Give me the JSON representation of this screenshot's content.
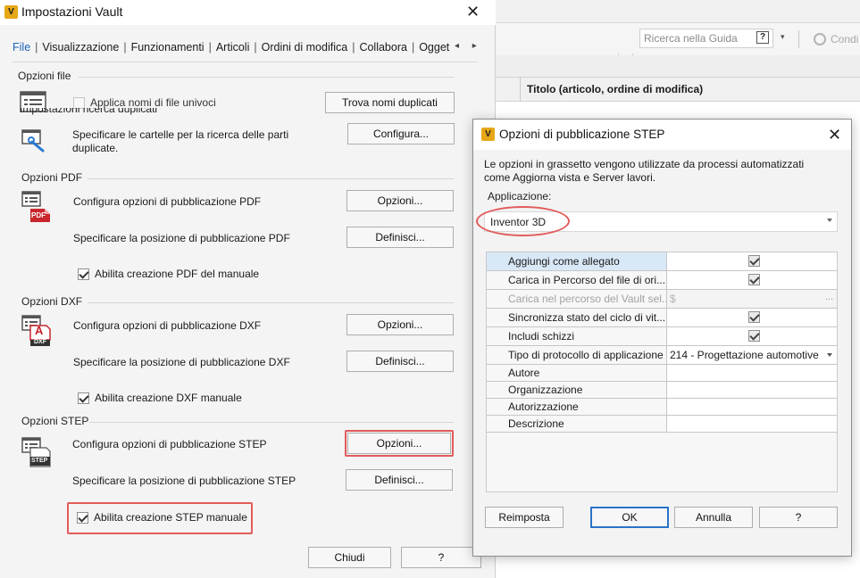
{
  "background_app": {
    "search_placeholder": "Ricerca nella Guida",
    "help_glyph": "?",
    "conditions_label": "Condi",
    "column_title": "Titolo (articolo, ordine di modifica)"
  },
  "settings_dialog": {
    "logo_letter": "V",
    "title": "Impostazioni Vault",
    "close_glyph": "✕",
    "tabs": [
      {
        "label": "File"
      },
      {
        "label": "Visualizzazione"
      },
      {
        "label": "Funzionamenti"
      },
      {
        "label": "Articoli"
      },
      {
        "label": "Ordini di modifica"
      },
      {
        "label": "Collabora"
      },
      {
        "label": "Ogget"
      }
    ],
    "tab_separator": "|",
    "tab_arrows": "◂ ▸",
    "file_options": {
      "heading": "Opzioni file",
      "unique_names_label": "Applica nomi di file univoci",
      "find_duplicates_button": "Trova nomi duplicati",
      "dup_search_heading": "Impostazioni ricerca duplicati",
      "dup_search_desc_1": "Specificare le cartelle per la ricerca delle parti",
      "dup_search_desc_2": "duplicate.",
      "configure_button": "Configura..."
    },
    "pdf": {
      "heading": "Opzioni PDF",
      "icon_label": "PDF",
      "configure_label": "Configura opzioni di pubblicazione PDF",
      "options_button": "Opzioni...",
      "location_label": "Specificare la posizione di pubblicazione PDF",
      "define_button": "Definisci...",
      "manual_label": "Abilita creazione PDF del manuale"
    },
    "dxf": {
      "heading": "Opzioni DXF",
      "icon_label": "DXF",
      "icon_letter": "A",
      "configure_label": "Configura opzioni di pubblicazione DXF",
      "options_button": "Opzioni...",
      "location_label": "Specificare la posizione di pubblicazione DXF",
      "define_button": "Definisci...",
      "manual_label": "Abilita creazione DXF manuale"
    },
    "step": {
      "heading": "Opzioni STEP",
      "icon_label": "STEP",
      "configure_label": "Configura opzioni di pubblicazione STEP",
      "options_button": "Opzioni...",
      "location_label": "Specificare la posizione di pubblicazione STEP",
      "define_button": "Definisci...",
      "manual_label": "Abilita creazione STEP manuale"
    },
    "close_button": "Chiudi",
    "help_button": "?"
  },
  "step_dialog": {
    "logo_letter": "V",
    "title": "Opzioni di pubblicazione STEP",
    "close_glyph": "✕",
    "description_1": "Le opzioni in grassetto vengono utilizzate da processi automatizzati",
    "description_2": "come Aggiorna vista e Server lavori.",
    "application_label": "Applicazione:",
    "application_value": "Inventor 3D",
    "properties": [
      {
        "name": "Aggiungi come allegato",
        "value": "",
        "checked": true
      },
      {
        "name": "Carica in Percorso del file di ori...",
        "value": "",
        "checked": true
      },
      {
        "name": "Carica nel percorso del Vault sel...",
        "value": "$",
        "disabled": true
      },
      {
        "name": "Sincronizza stato del ciclo di vit...",
        "value": "",
        "checked": true
      },
      {
        "name": "Includi schizzi",
        "value": "",
        "checked": true
      },
      {
        "name": "Tipo di protocollo di applicazione",
        "value": "214 - Progettazione automotive"
      },
      {
        "name": "Autore",
        "value": ""
      },
      {
        "name": "Organizzazione",
        "value": ""
      },
      {
        "name": "Autorizzazione",
        "value": ""
      },
      {
        "name": "Descrizione",
        "value": ""
      }
    ],
    "ellipsis": "...",
    "reset_button": "Reimposta",
    "ok_button": "OK",
    "cancel_button": "Annulla",
    "help_button": "?"
  },
  "colors": {
    "accent_blue": "#1b65b5",
    "highlight_red": "#e25b5b",
    "vault_logo": "#e6a817",
    "pdf_red": "#c8262c"
  }
}
